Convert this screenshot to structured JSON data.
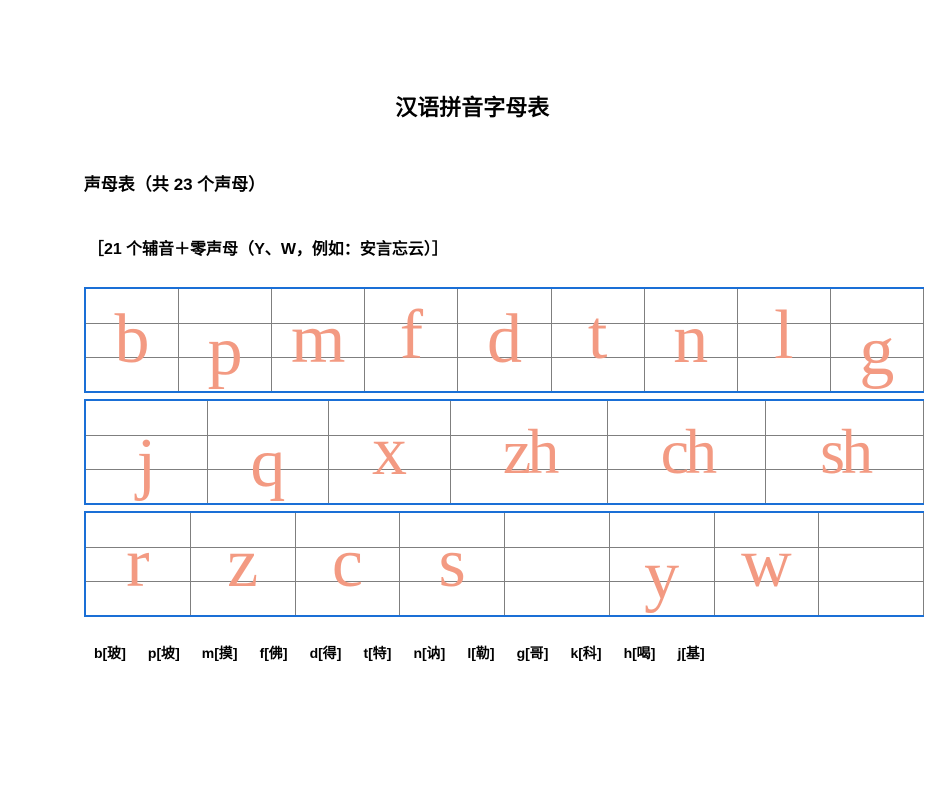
{
  "title": "汉语拼音字母表",
  "subtitle": "声母表（共 23 个声母）",
  "subnote": "［21 个辅音＋零声母（Y、W，例如：安言忘云）］",
  "rows": [
    {
      "cells": [
        "b",
        "p",
        "m",
        "f",
        "d",
        "t",
        "n",
        "l",
        "g"
      ]
    },
    {
      "cells": [
        "j",
        "q",
        "x",
        "zh",
        "ch",
        "sh"
      ]
    },
    {
      "cells": [
        "r",
        "z",
        "c",
        "s",
        "",
        "y",
        "w",
        ""
      ]
    }
  ],
  "legend": [
    "b[玻]",
    "p[坡]",
    "m[摸]",
    "f[佛]",
    "d[得]",
    "t[特]",
    "n[讷]",
    "l[勒]",
    "g[哥]",
    "k[科]",
    "h[喝]",
    "j[基]"
  ]
}
